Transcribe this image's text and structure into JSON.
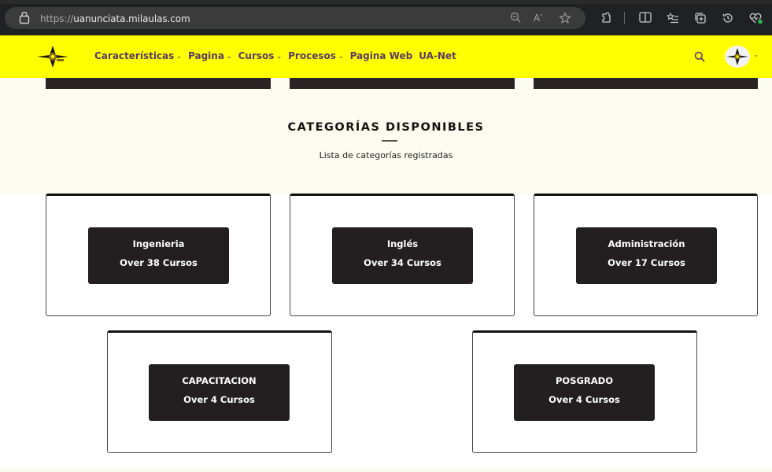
{
  "browser": {
    "url_protocol": "https://",
    "url_host": "uanunciata.milaulas.com"
  },
  "header": {
    "nav": [
      {
        "label": "Características",
        "has_dropdown": true
      },
      {
        "label": "Pagina",
        "has_dropdown": true
      },
      {
        "label": "Cursos",
        "has_dropdown": true
      },
      {
        "label": "Procesos",
        "has_dropdown": true
      },
      {
        "label": "Pagina Web",
        "has_dropdown": false
      },
      {
        "label": "UA-Net",
        "has_dropdown": false
      }
    ]
  },
  "section": {
    "title": "CATEGORÍAS DISPONIBLES",
    "subtitle": "Lista de categorías registradas"
  },
  "categories": [
    {
      "name": "Ingenieria",
      "count": "Over 38 Cursos"
    },
    {
      "name": "Inglés",
      "count": "Over 34 Cursos"
    },
    {
      "name": "Administración",
      "count": "Over 17 Cursos"
    },
    {
      "name": "CAPACITACION",
      "count": "Over 4 Cursos"
    },
    {
      "name": "POSGRADO",
      "count": "Over 4 Cursos"
    }
  ],
  "colors": {
    "header_bg": "#ffff00",
    "nav_text": "#5b3a66",
    "card_button_bg": "#231f20",
    "section_bg": "#fbfcef"
  }
}
